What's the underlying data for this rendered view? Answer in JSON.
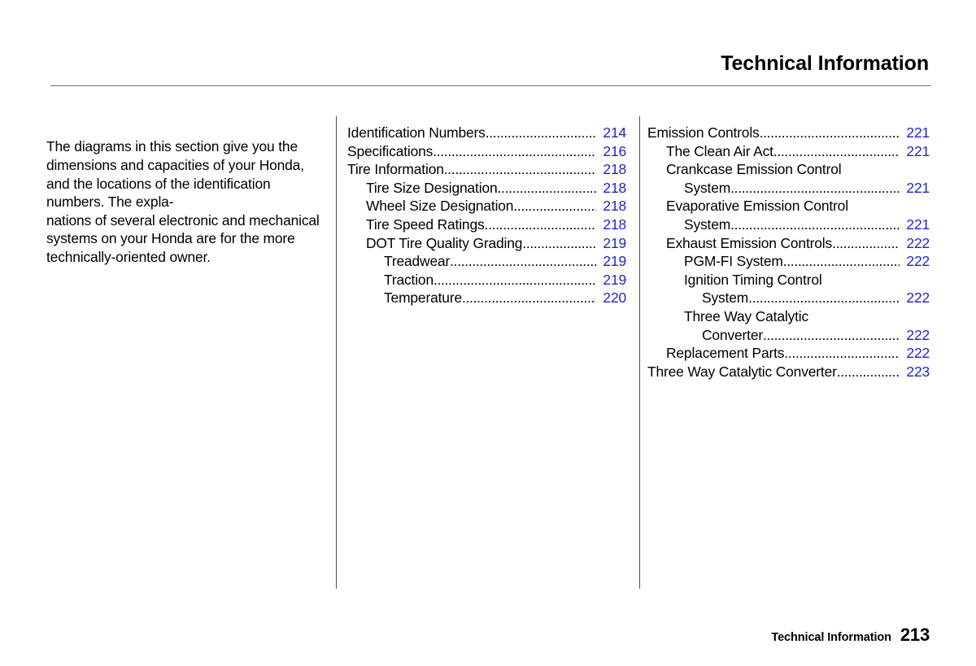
{
  "header": {
    "title": "Technical Information"
  },
  "intro": {
    "text": "The diagrams in this section give you the dimensions and capacities of your Honda, and the locations of the identification numbers. The expla-\nnations of several electronic and mechanical systems on your Honda are for the more technically-oriented owner."
  },
  "toc": {
    "leader_dots": "................................................................",
    "middle_column": [
      {
        "label": "Identification Numbers",
        "page": "214",
        "level": 0,
        "leader": true
      },
      {
        "label": "Specifications",
        "page": "216",
        "level": 0,
        "leader": true
      },
      {
        "label": "Tire Information",
        "page": "218",
        "level": 0,
        "leader": true
      },
      {
        "label": "Tire Size Designation",
        "page": "218",
        "level": 1,
        "leader": true
      },
      {
        "label": "Wheel Size Designation",
        "page": "218",
        "level": 1,
        "leader": true
      },
      {
        "label": "Tire Speed Ratings",
        "page": "218",
        "level": 1,
        "leader": true
      },
      {
        "label": "DOT Tire Quality Grading",
        "page": "219",
        "level": 1,
        "leader": true
      },
      {
        "label": "Treadwear",
        "page": "219",
        "level": 2,
        "leader": true
      },
      {
        "label": "Traction",
        "page": "219",
        "level": 2,
        "leader": true
      },
      {
        "label": "Temperature",
        "page": "220",
        "level": 2,
        "leader": true
      }
    ],
    "right_column": [
      {
        "label": "Emission Controls",
        "page": "221",
        "level": 0,
        "leader": true
      },
      {
        "label": "The Clean Air Act",
        "page": "221",
        "level": 1,
        "leader": true
      },
      {
        "label": "Crankcase Emission Control",
        "page": "",
        "level": 1,
        "leader": false
      },
      {
        "label": "System",
        "page": "221",
        "level": 2,
        "leader": true
      },
      {
        "label": "Evaporative Emission Control",
        "page": "",
        "level": 1,
        "leader": false
      },
      {
        "label": "System",
        "page": "221",
        "level": 2,
        "leader": true
      },
      {
        "label": "Exhaust Emission Controls",
        "page": "222",
        "level": 1,
        "leader": true
      },
      {
        "label": "PGM-FI System",
        "page": "222",
        "level": 2,
        "leader": true
      },
      {
        "label": "Ignition Timing Control",
        "page": "",
        "level": 2,
        "leader": false
      },
      {
        "label": "System",
        "page": "222",
        "level": 3,
        "leader": true
      },
      {
        "label": "Three Way Catalytic",
        "page": "",
        "level": 2,
        "leader": false
      },
      {
        "label": "Converter",
        "page": "222",
        "level": 3,
        "leader": true
      },
      {
        "label": "Replacement Parts",
        "page": "222",
        "level": 1,
        "leader": true
      },
      {
        "label": "Three Way Catalytic Converter",
        "page": "223",
        "level": 0,
        "leader": true
      }
    ]
  },
  "footer": {
    "section": "Technical Information",
    "page_number": "213"
  },
  "colors": {
    "page_number_blue": "#2322cc",
    "rule_gray": "#6d6d6d",
    "divider_gray": "#4d4d4d",
    "text_black": "#000000"
  }
}
